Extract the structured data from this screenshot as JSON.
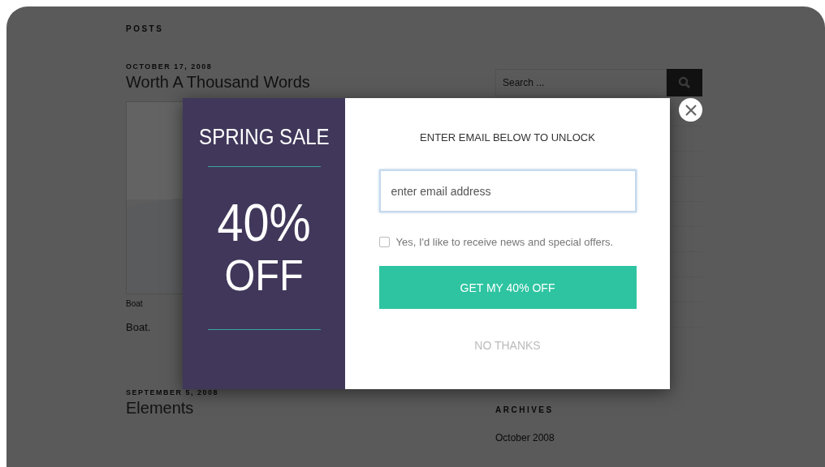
{
  "page": {
    "posts_heading": "POSTS",
    "posts": [
      {
        "date": "OCTOBER 17, 2008",
        "title": "Worth A Thousand Words",
        "caption": "Boat",
        "excerpt": "Boat."
      },
      {
        "date": "SEPTEMBER 5, 2008",
        "title": "Elements"
      }
    ],
    "sidebar": {
      "search": {
        "placeholder": "Search ..."
      },
      "archives": {
        "heading": "ARCHIVES",
        "items": [
          "October 2008"
        ]
      }
    }
  },
  "popup": {
    "promo": {
      "title": "SPRING SALE",
      "amount": "40%",
      "suffix": "OFF"
    },
    "heading": "ENTER EMAIL BELOW TO UNLOCK",
    "email": {
      "placeholder": "enter email address",
      "focused": true
    },
    "consent": {
      "label": "Yes, I'd like to receive news and special offers.",
      "checked": false
    },
    "submit": "GET MY 40% OFF",
    "decline": "NO THANKS"
  }
}
